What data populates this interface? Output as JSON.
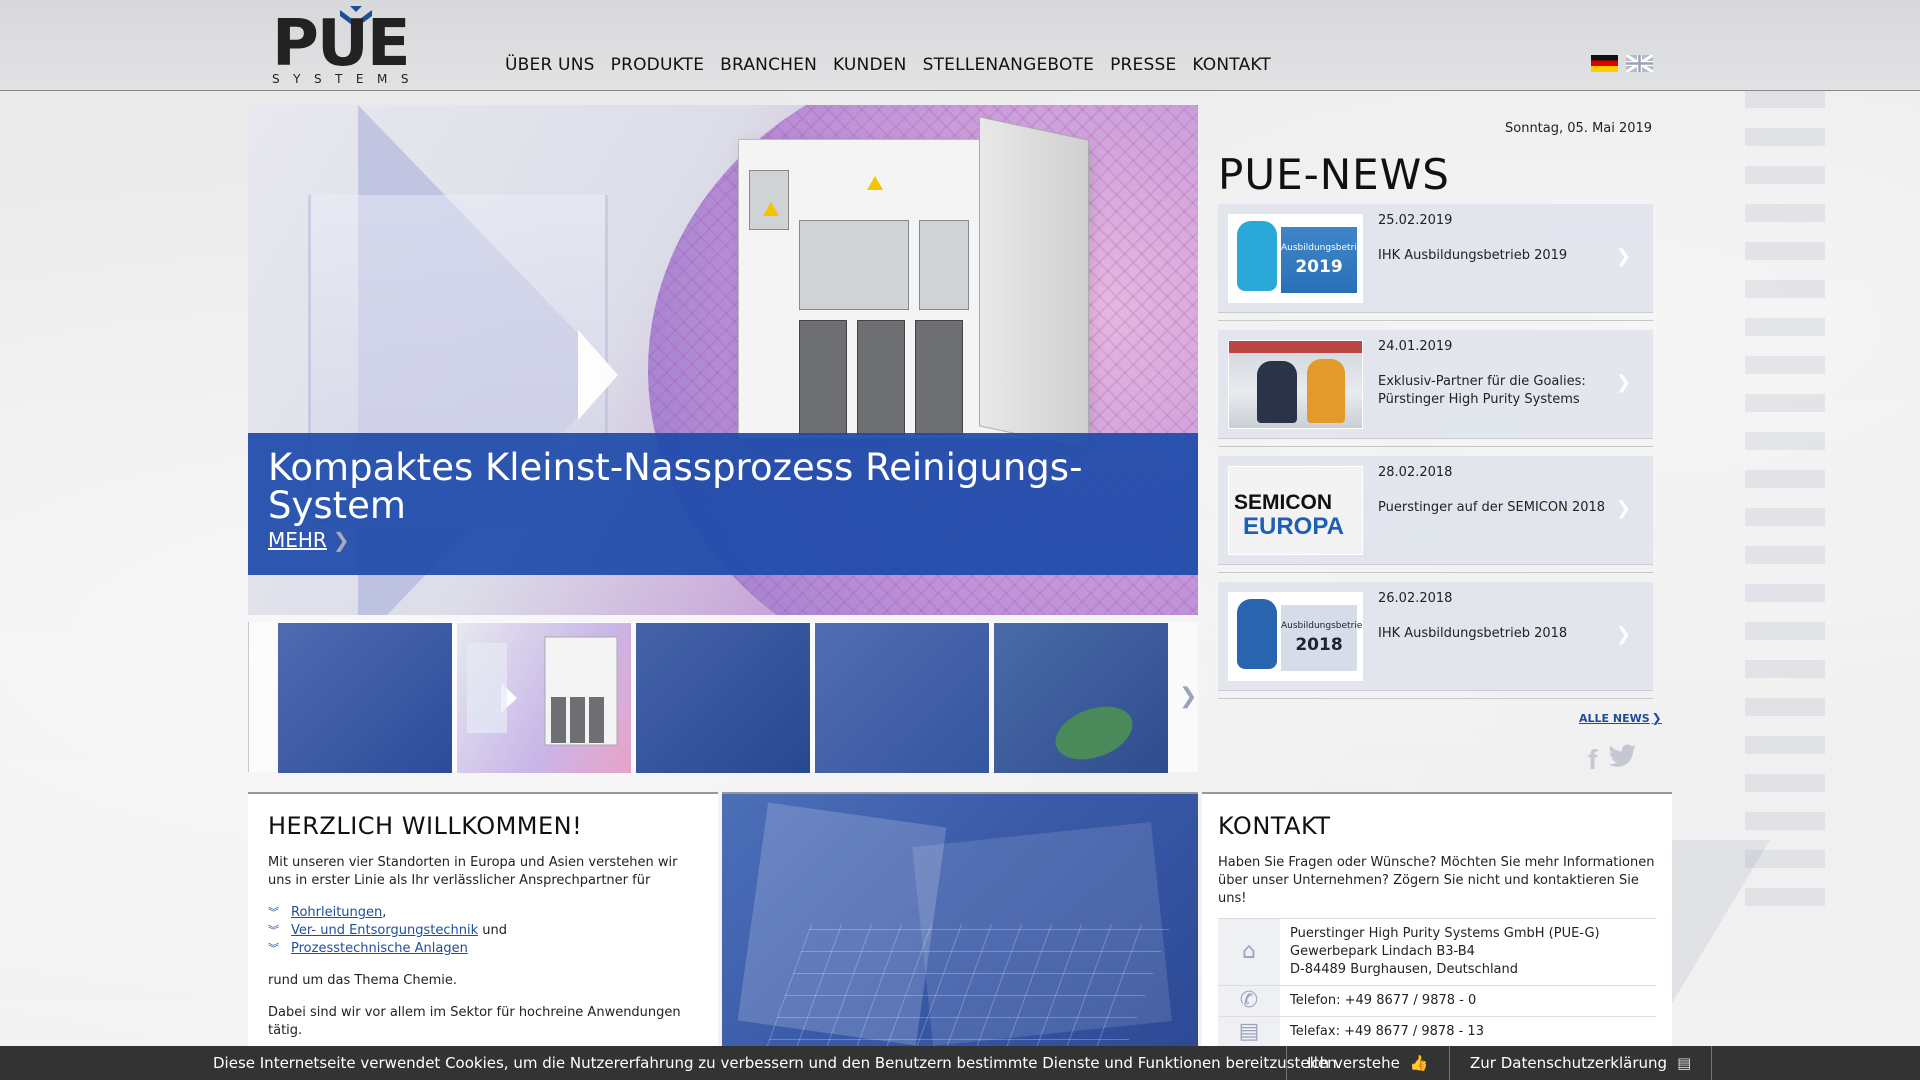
{
  "header": {
    "logo_text": "PUE",
    "logo_sub": "SYSTEMS",
    "nav": [
      "ÜBER UNS",
      "PRODUKTE",
      "BRANCHEN",
      "KUNDEN",
      "STELLENANGEBOTE",
      "PRESSE",
      "KONTAKT"
    ],
    "languages": [
      "de-flag-icon",
      "uk-flag-icon"
    ]
  },
  "hero": {
    "title": "Kompaktes Kleinst-Nassprozess Reinigungs-System",
    "more_label": "MEHR",
    "caption_color": "#1e4baa"
  },
  "thumbnails": [
    "thumb-1",
    "thumb-2",
    "thumb-3",
    "thumb-4",
    "thumb-5"
  ],
  "news": {
    "date_line": "Sonntag, 05. Mai 2019",
    "title": "PUE-NEWS",
    "items": [
      {
        "date": "25.02.2019",
        "text": "IHK Ausbildungsbetrieb 2019"
      },
      {
        "date": "24.01.2019",
        "text": "Exklusiv-Partner für die Goalies: Pürstinger High Purity Systems"
      },
      {
        "date": "28.02.2018",
        "text": "Puerstinger auf der SEMICON 2018"
      },
      {
        "date": "26.02.2018",
        "text": "IHK Ausbildungsbetrieb 2018"
      }
    ],
    "thumb_texts": {
      "ihk_small": "Ausbildungsbetrieb",
      "ihk_2019": "2019",
      "ihk_2018": "2018",
      "semicon_1": "SEMICON",
      "semicon_2": "EUROPA"
    },
    "all_news": "ALLE NEWS",
    "social": [
      "facebook-icon",
      "twitter-icon"
    ]
  },
  "welcome": {
    "title": "HERZLICH WILLKOMMEN!",
    "intro": "Mit unseren vier Standorten in Europa und Asien verstehen wir uns in erster Linie als Ihr verlässlicher Ansprechpartner für",
    "links": [
      {
        "label": "Rohrleitungen",
        "suffix": ","
      },
      {
        "label": "Ver- und Entsorgungstechnik",
        "suffix": " und"
      },
      {
        "label": "Prozesstechnische Anlagen",
        "suffix": ""
      }
    ],
    "para2": "rund um das Thema Chemie.",
    "para3": "Dabei sind wir vor allem im Sektor für hochreine Anwendungen tätig."
  },
  "contact": {
    "title": "KONTAKT",
    "intro": "Haben Sie Fragen oder Wünsche? Möchten Sie mehr Informationen über unser Unternehmen? Zögern Sie nicht und kontaktieren Sie uns!",
    "address_line1": "Puerstinger High Purity Systems GmbH (PUE-G)",
    "address_line2": "Gewerbepark Lindach B3-B4",
    "address_line3": "D-84489 Burghausen, Deutschland",
    "phone": "Telefon: +49 8677 / 9878 - 0",
    "fax": "Telefax: +49 8677 / 9878 - 13"
  },
  "cookie": {
    "text": "Diese Internetseite verwendet Cookies, um die Nutzererfahrung zu verbessern und den Benutzern bestimmte Dienste und Funktionen bereitzustellen.",
    "accept": "Ich verstehe",
    "privacy": "Zur Datenschutzerklärung"
  }
}
